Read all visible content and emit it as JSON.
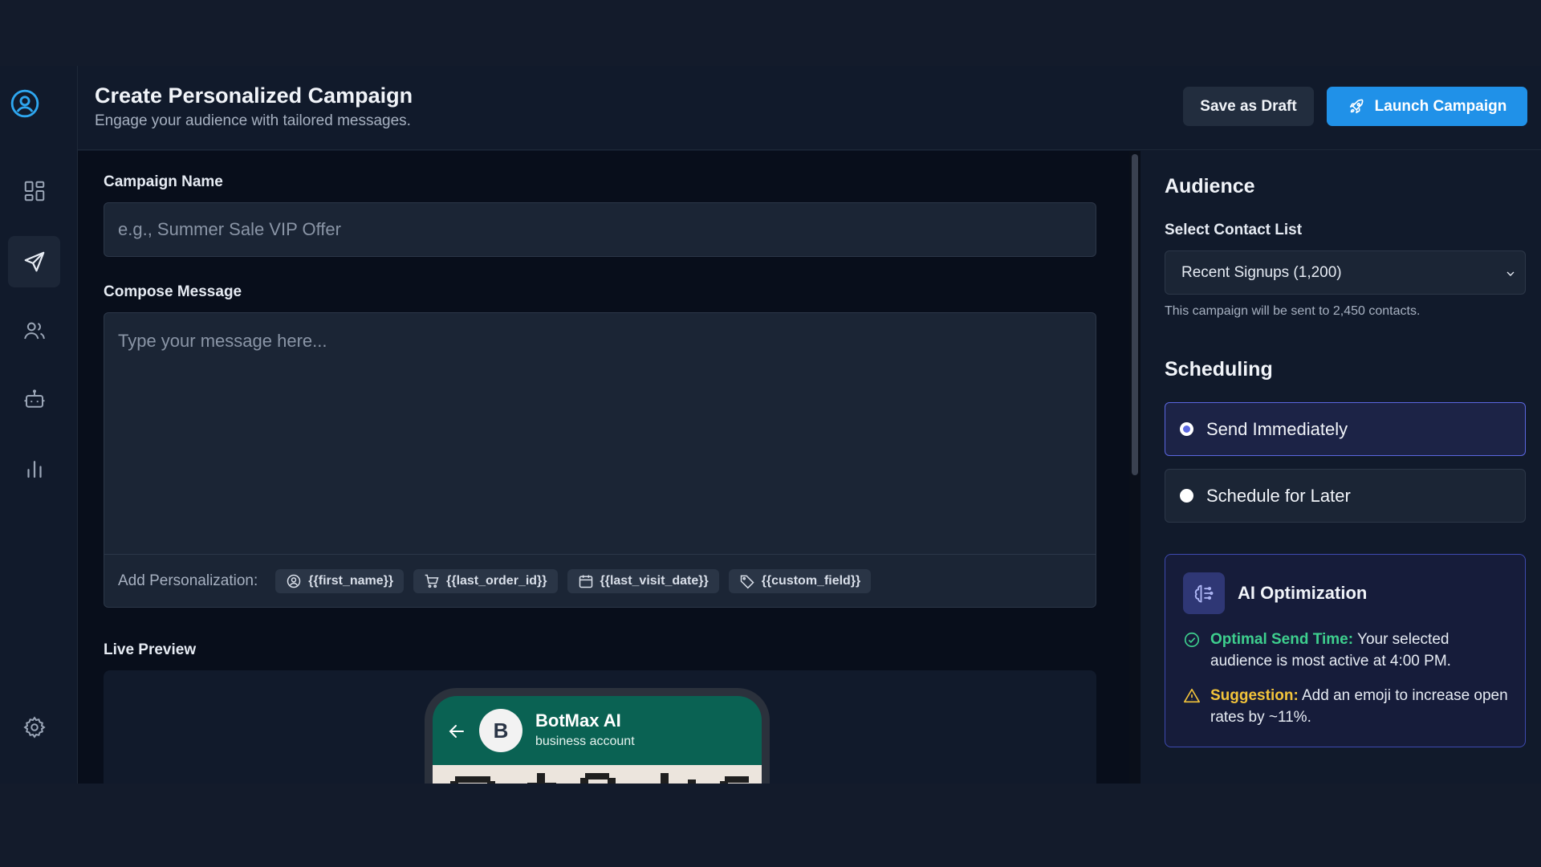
{
  "header": {
    "title": "Create Personalized Campaign",
    "subtitle": "Engage your audience with tailored messages.",
    "save_draft_label": "Save as Draft",
    "launch_label": "Launch Campaign"
  },
  "sidebar": {
    "items": [
      {
        "name": "dashboard-grid-icon"
      },
      {
        "name": "send-icon",
        "active": true
      },
      {
        "name": "users-icon"
      },
      {
        "name": "bot-icon"
      },
      {
        "name": "bar-chart-icon"
      },
      {
        "name": "settings-gear-icon"
      }
    ]
  },
  "form": {
    "campaign_name_label": "Campaign Name",
    "campaign_name_placeholder": "e.g., Summer Sale VIP Offer",
    "campaign_name_value": "",
    "compose_label": "Compose Message",
    "compose_placeholder": "Type your message here...",
    "compose_value": "",
    "personalization_label": "Add Personalization:",
    "tokens": [
      "{{first_name}}",
      "{{last_order_id}}",
      "{{last_visit_date}}",
      "{{custom_field}}"
    ],
    "live_preview_label": "Live Preview"
  },
  "preview": {
    "avatar_letter": "B",
    "bot_name": "BotMax AI",
    "bot_subtitle": "business account"
  },
  "audience": {
    "heading": "Audience",
    "select_label": "Select Contact List",
    "selected_list": "Recent Signups (1,200)",
    "hint": "This campaign will be sent to 2,450 contacts."
  },
  "scheduling": {
    "heading": "Scheduling",
    "options": [
      "Send Immediately",
      "Schedule for Later"
    ],
    "selected_index": 0
  },
  "ai": {
    "title": "AI Optimization",
    "optimal_label": "Optimal Send Time:",
    "optimal_text": " Your selected audience is most active at 4:00 PM.",
    "suggestion_label": "Suggestion:",
    "suggestion_text": " Add an emoji to increase open rates by ~11%."
  },
  "colors": {
    "accent": "#2091e8",
    "radio_selected": "#5b67e0",
    "success": "#3ecf8e",
    "warning": "#f3c43a"
  }
}
